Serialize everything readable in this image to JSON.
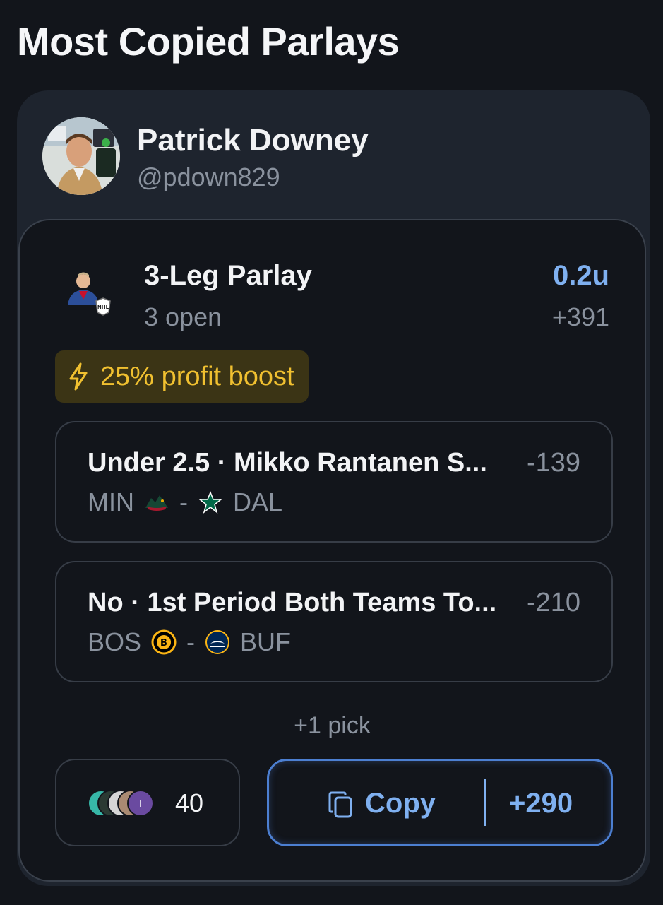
{
  "section_title": "Most Copied Parlays",
  "user": {
    "name": "Patrick Downey",
    "handle": "@pdown829"
  },
  "parlay": {
    "title": "3-Leg Parlay",
    "status": "3 open",
    "units": "0.2u",
    "odds": "+391",
    "boost": "25% profit boost",
    "legs": [
      {
        "title": "Under 2.5 · Mikko Rantanen S...",
        "odds": "-139",
        "home": "MIN",
        "separator": "-",
        "away": "DAL"
      },
      {
        "title": "No · 1st Period Both Teams To...",
        "odds": "-210",
        "home": "BOS",
        "separator": "-",
        "away": "BUF"
      }
    ],
    "more_picks": "+1 pick",
    "copiers_count": "40",
    "copy_label": "Copy",
    "copy_odds": "+290"
  },
  "colors": {
    "accent": "#7fb0f0",
    "boost": "#f0c030",
    "muted": "#8a929e"
  },
  "icons": [
    "avatar-photo",
    "player-headshot-icon",
    "nhl-logo-icon",
    "lightning-icon",
    "wild-logo-icon",
    "stars-logo-icon",
    "bruins-logo-icon",
    "sabres-logo-icon",
    "copy-icon"
  ]
}
